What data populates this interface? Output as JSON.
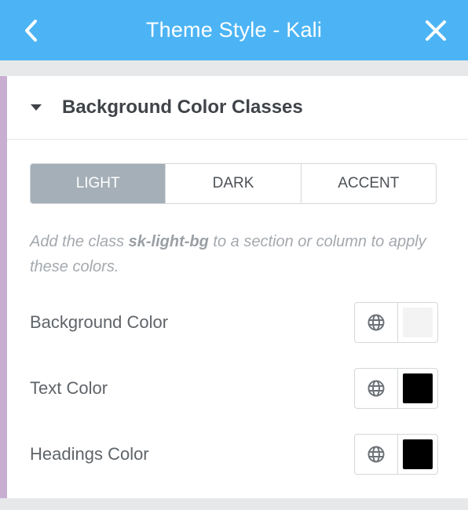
{
  "header": {
    "title": "Theme Style - Kali",
    "back_icon": "chevron-left-icon",
    "close_icon": "close-icon",
    "color": "#4cb4f4"
  },
  "section": {
    "title": "Background Color Classes",
    "expanded": true
  },
  "tabs": [
    {
      "label": "LIGHT",
      "active": true
    },
    {
      "label": "DARK",
      "active": false
    },
    {
      "label": "ACCENT",
      "active": false
    }
  ],
  "description": {
    "prefix": "Add the class ",
    "class_name": "sk-light-bg",
    "suffix": " to a section or column to apply these colors."
  },
  "color_rows": [
    {
      "label": "Background Color",
      "swatch": "#f3f3f3",
      "global_icon": "globe-icon"
    },
    {
      "label": "Text Color",
      "swatch": "#000000",
      "global_icon": "globe-icon"
    },
    {
      "label": "Headings Color",
      "swatch": "#000000",
      "global_icon": "globe-icon"
    }
  ]
}
